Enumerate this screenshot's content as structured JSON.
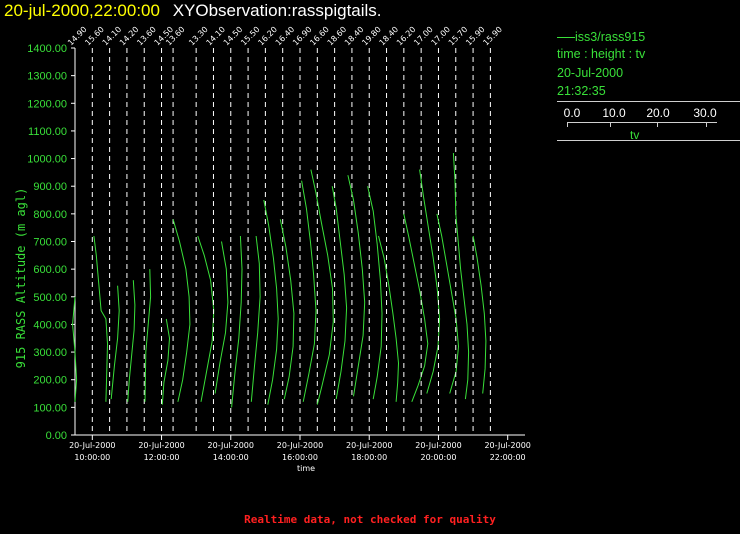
{
  "title": {
    "date": "20-jul-2000,22:00:00",
    "name": "XYObservation:rasspigtails."
  },
  "legend": {
    "series": "iss3/rass915",
    "axes": "time : height : tv",
    "date": "20-Jul-2000",
    "time": "21:32:35",
    "scale_labels": [
      "0.0",
      "10.0",
      "20.0",
      "30.0"
    ],
    "scale_unit": "tv"
  },
  "footer": "Realtime data, not checked for quality",
  "colors": {
    "data": "#39e039",
    "title_date": "#ffff00",
    "footer": "#ff2020",
    "axis": "#ffffff"
  },
  "chart_data": {
    "type": "line",
    "xlabel": "time",
    "ylabel": "915 RASS Altitude (m agl)",
    "ylim": [
      0,
      1400
    ],
    "xlim": [
      "2000-07-20 09:30",
      "2000-07-20 22:30"
    ],
    "yticks": [
      "0.00",
      "100.00",
      "200.00",
      "300.00",
      "400.00",
      "500.00",
      "600.00",
      "700.00",
      "800.00",
      "900.00",
      "1000.00",
      "1100.00",
      "1200.00",
      "1300.00",
      "1400.00"
    ],
    "xticks": [
      {
        "date": "20-Jul-2000",
        "time": "10:00:00"
      },
      {
        "date": "20-Jul-2000",
        "time": "12:00:00"
      },
      {
        "date": "20-Jul-2000",
        "time": "14:00:00"
      },
      {
        "date": "20-Jul-2000",
        "time": "16:00:00"
      },
      {
        "date": "20-Jul-2000",
        "time": "18:00:00"
      },
      {
        "date": "20-Jul-2000",
        "time": "20:00:00"
      },
      {
        "date": "20-Jul-2000",
        "time": "22:00:00"
      }
    ],
    "grid": false,
    "profiles": [
      {
        "t": "09:30",
        "base": "14.90",
        "points": [
          [
            0.0,
            500
          ],
          [
            -0.3,
            400
          ],
          [
            0.0,
            300
          ],
          [
            0.2,
            200
          ],
          [
            0.0,
            120
          ]
        ]
      },
      {
        "t": "10:00",
        "base": "15.60",
        "points": [
          [
            0.2,
            720
          ],
          [
            0.5,
            650
          ],
          [
            0.8,
            550
          ],
          [
            1.1,
            450
          ],
          [
            1.7,
            420
          ],
          [
            1.9,
            330
          ],
          [
            1.8,
            220
          ],
          [
            1.7,
            120
          ]
        ]
      },
      {
        "t": "10:30",
        "base": "14.10",
        "points": [
          [
            1.0,
            540
          ],
          [
            1.2,
            450
          ],
          [
            1.0,
            350
          ],
          [
            0.6,
            250
          ],
          [
            0.2,
            130
          ]
        ]
      },
      {
        "t": "11:00",
        "base": "14.20",
        "points": [
          [
            0.8,
            560
          ],
          [
            1.0,
            470
          ],
          [
            0.9,
            380
          ],
          [
            0.6,
            290
          ],
          [
            0.3,
            200
          ],
          [
            0.1,
            120
          ]
        ]
      },
      {
        "t": "11:30",
        "base": "13.60",
        "points": [
          [
            0.7,
            600
          ],
          [
            0.8,
            500
          ],
          [
            0.5,
            400
          ],
          [
            0.2,
            300
          ],
          [
            0.1,
            120
          ]
        ]
      },
      {
        "t": "12:00",
        "base": "14.50",
        "points": [
          [
            0.6,
            420
          ],
          [
            1.0,
            350
          ],
          [
            0.8,
            270
          ],
          [
            0.3,
            190
          ],
          [
            0.1,
            110
          ]
        ]
      },
      {
        "t": "12:20",
        "base": "13.60",
        "points": [
          [
            0.0,
            780
          ],
          [
            0.8,
            700
          ],
          [
            1.6,
            600
          ],
          [
            2.0,
            500
          ],
          [
            2.1,
            400
          ],
          [
            1.7,
            300
          ],
          [
            1.2,
            200
          ],
          [
            0.6,
            120
          ]
        ]
      },
      {
        "t": "13:00",
        "base": "13.30",
        "points": [
          [
            0.2,
            720
          ],
          [
            1.0,
            650
          ],
          [
            1.8,
            560
          ],
          [
            2.2,
            450
          ],
          [
            2.0,
            340
          ],
          [
            1.3,
            230
          ],
          [
            0.6,
            120
          ]
        ]
      },
      {
        "t": "13:30",
        "base": "14.10",
        "points": [
          [
            1.0,
            700
          ],
          [
            1.6,
            600
          ],
          [
            1.8,
            480
          ],
          [
            1.5,
            370
          ],
          [
            0.8,
            260
          ],
          [
            0.2,
            150
          ]
        ]
      },
      {
        "t": "14:00",
        "base": "14.50",
        "points": [
          [
            1.2,
            720
          ],
          [
            1.4,
            600
          ],
          [
            1.3,
            480
          ],
          [
            1.0,
            350
          ],
          [
            0.5,
            220
          ],
          [
            0.1,
            100
          ]
        ]
      },
      {
        "t": "14:30",
        "base": "15.50",
        "points": [
          [
            1.0,
            720
          ],
          [
            1.4,
            620
          ],
          [
            1.5,
            500
          ],
          [
            1.2,
            370
          ],
          [
            0.8,
            250
          ],
          [
            0.4,
            120
          ]
        ]
      },
      {
        "t": "15:00",
        "base": "16.20",
        "points": [
          [
            -0.2,
            850
          ],
          [
            0.4,
            760
          ],
          [
            1.0,
            640
          ],
          [
            1.4,
            530
          ],
          [
            1.6,
            420
          ],
          [
            1.4,
            310
          ],
          [
            0.9,
            200
          ],
          [
            0.3,
            110
          ]
        ]
      },
      {
        "t": "15:30",
        "base": "16.40",
        "points": [
          [
            -0.3,
            780
          ],
          [
            0.4,
            680
          ],
          [
            1.0,
            560
          ],
          [
            1.4,
            440
          ],
          [
            1.3,
            320
          ],
          [
            0.8,
            210
          ],
          [
            0.2,
            130
          ]
        ]
      },
      {
        "t": "16:00",
        "base": "16.90",
        "points": [
          [
            0.2,
            920
          ],
          [
            0.8,
            820
          ],
          [
            1.3,
            700
          ],
          [
            1.7,
            580
          ],
          [
            2.0,
            450
          ],
          [
            1.8,
            330
          ],
          [
            1.1,
            220
          ],
          [
            0.4,
            120
          ]
        ]
      },
      {
        "t": "16:30",
        "base": "16.60",
        "points": [
          [
            -0.8,
            960
          ],
          [
            -0.2,
            880
          ],
          [
            0.5,
            770
          ],
          [
            1.3,
            650
          ],
          [
            1.9,
            530
          ],
          [
            2.0,
            410
          ],
          [
            1.5,
            290
          ],
          [
            0.6,
            180
          ],
          [
            0.0,
            110
          ]
        ]
      },
      {
        "t": "17:00",
        "base": "18.60",
        "points": [
          [
            -0.3,
            900
          ],
          [
            0.2,
            820
          ],
          [
            0.7,
            700
          ],
          [
            1.2,
            580
          ],
          [
            1.5,
            460
          ],
          [
            1.3,
            340
          ],
          [
            0.8,
            230
          ],
          [
            0.2,
            130
          ]
        ]
      },
      {
        "t": "17:30",
        "base": "18.40",
        "points": [
          [
            -0.5,
            940
          ],
          [
            0.2,
            850
          ],
          [
            0.8,
            730
          ],
          [
            1.3,
            600
          ],
          [
            1.6,
            480
          ],
          [
            1.4,
            360
          ],
          [
            0.8,
            250
          ],
          [
            0.2,
            140
          ]
        ]
      },
      {
        "t": "18:00",
        "base": "19.80",
        "points": [
          [
            -0.2,
            900
          ],
          [
            0.5,
            810
          ],
          [
            1.0,
            690
          ],
          [
            1.4,
            560
          ],
          [
            1.6,
            440
          ],
          [
            1.5,
            320
          ],
          [
            1.0,
            210
          ],
          [
            0.5,
            130
          ]
        ]
      },
      {
        "t": "18:30",
        "base": "18.40",
        "points": [
          [
            -1.0,
            720
          ],
          [
            -0.3,
            640
          ],
          [
            0.3,
            540
          ],
          [
            0.8,
            440
          ],
          [
            1.2,
            350
          ],
          [
            1.5,
            260
          ],
          [
            1.4,
            190
          ],
          [
            1.2,
            120
          ]
        ]
      },
      {
        "t": "19:00",
        "base": "16.20",
        "points": [
          [
            0.0,
            800
          ],
          [
            0.6,
            720
          ],
          [
            1.3,
            620
          ],
          [
            2.0,
            520
          ],
          [
            2.6,
            420
          ],
          [
            3.0,
            330
          ],
          [
            2.6,
            250
          ],
          [
            1.8,
            180
          ],
          [
            1.0,
            120
          ]
        ]
      },
      {
        "t": "19:30",
        "base": "17.00",
        "points": [
          [
            -0.2,
            960
          ],
          [
            0.3,
            860
          ],
          [
            0.9,
            750
          ],
          [
            1.5,
            640
          ],
          [
            2.0,
            530
          ],
          [
            2.3,
            420
          ],
          [
            2.1,
            320
          ],
          [
            1.5,
            230
          ],
          [
            0.7,
            150
          ]
        ]
      },
      {
        "t": "20:00",
        "base": "17.00",
        "points": [
          [
            -0.2,
            800
          ],
          [
            0.4,
            720
          ],
          [
            1.0,
            620
          ],
          [
            1.6,
            520
          ],
          [
            2.2,
            420
          ],
          [
            2.5,
            320
          ],
          [
            2.2,
            230
          ],
          [
            1.4,
            150
          ]
        ]
      },
      {
        "t": "20:30",
        "base": "15.70",
        "points": [
          [
            -0.3,
            1020
          ],
          [
            -0.1,
            920
          ],
          [
            0.0,
            800
          ],
          [
            0.3,
            700
          ],
          [
            0.6,
            600
          ],
          [
            1.0,
            500
          ],
          [
            1.4,
            400
          ],
          [
            1.6,
            300
          ],
          [
            1.5,
            200
          ],
          [
            1.2,
            130
          ]
        ]
      },
      {
        "t": "21:00",
        "base": "15.90",
        "points": [
          [
            0.0,
            720
          ],
          [
            0.5,
            640
          ],
          [
            1.0,
            540
          ],
          [
            1.4,
            440
          ],
          [
            1.6,
            340
          ],
          [
            1.5,
            240
          ],
          [
            1.2,
            150
          ]
        ]
      },
      {
        "t": "21:30",
        "base": "15.90",
        "points": []
      }
    ]
  }
}
